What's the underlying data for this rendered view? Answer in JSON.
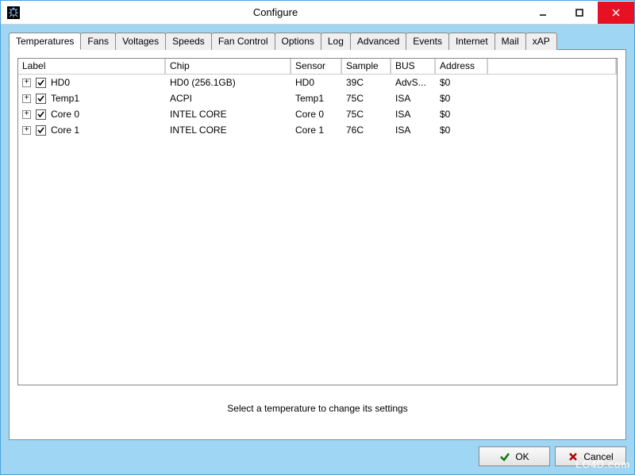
{
  "window": {
    "title": "Configure"
  },
  "tabs": [
    "Temperatures",
    "Fans",
    "Voltages",
    "Speeds",
    "Fan Control",
    "Options",
    "Log",
    "Advanced",
    "Events",
    "Internet",
    "Mail",
    "xAP"
  ],
  "active_tab": "Temperatures",
  "columns": [
    "Label",
    "Chip",
    "Sensor",
    "Sample",
    "BUS",
    "Address"
  ],
  "rows": [
    {
      "checked": true,
      "label": "HD0",
      "chip": "HD0 (256.1GB)",
      "sensor": "HD0",
      "sample": "39C",
      "bus": "AdvS...",
      "address": "$0"
    },
    {
      "checked": true,
      "label": "Temp1",
      "chip": "ACPI",
      "sensor": "Temp1",
      "sample": "75C",
      "bus": "ISA",
      "address": "$0"
    },
    {
      "checked": true,
      "label": "Core 0",
      "chip": "INTEL CORE",
      "sensor": "Core 0",
      "sample": "75C",
      "bus": "ISA",
      "address": "$0"
    },
    {
      "checked": true,
      "label": "Core 1",
      "chip": "INTEL CORE",
      "sensor": "Core 1",
      "sample": "76C",
      "bus": "ISA",
      "address": "$0"
    }
  ],
  "hint": "Select a temperature to change its settings",
  "buttons": {
    "ok": "OK",
    "cancel": "Cancel"
  },
  "watermark": "LO4D.com"
}
